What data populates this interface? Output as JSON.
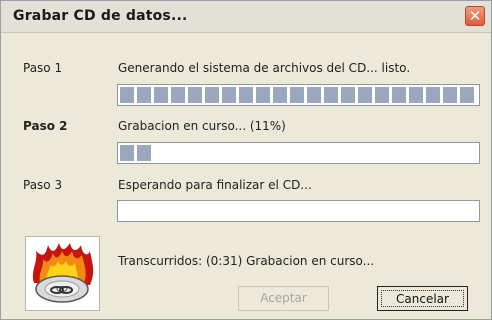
{
  "window": {
    "title": "Grabar CD de datos...",
    "close_glyph": "✕"
  },
  "steps": [
    {
      "label": "Paso 1",
      "text": "Generando el sistema de archivos del CD... listo.",
      "progress": 1.0,
      "active": false
    },
    {
      "label": "Paso 2",
      "text": "Grabacion en curso... (11%)",
      "progress": 0.11,
      "active": true
    },
    {
      "label": "Paso 3",
      "text": "Esperando para finalizar el CD...",
      "progress": 0.0,
      "active": false
    }
  ],
  "status": {
    "text": "Transcurridos: (0:31)    Grabacion en curso..."
  },
  "buttons": {
    "accept": "Aceptar",
    "cancel": "Cancelar"
  },
  "icon": {
    "name": "burning-cd-icon"
  },
  "colors": {
    "progress_fill": "#9aa8bd",
    "close_button": "#e05b3a"
  }
}
